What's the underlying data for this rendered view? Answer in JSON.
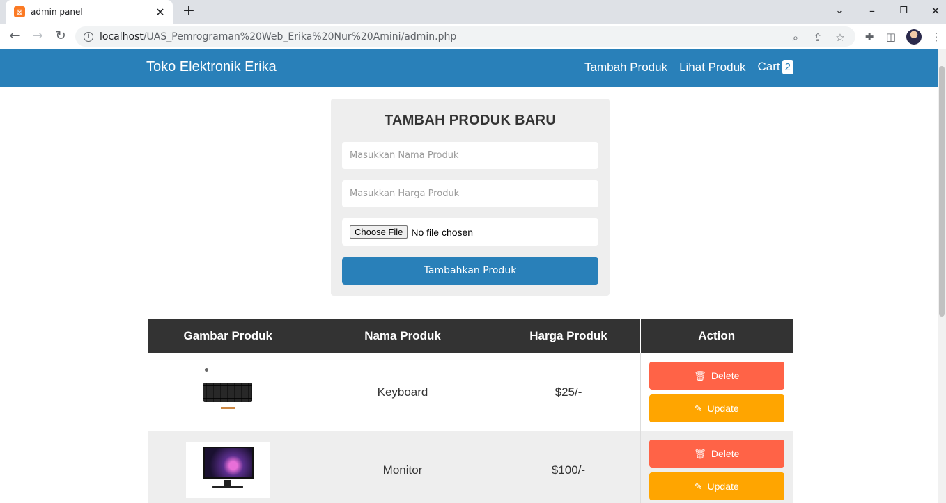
{
  "browser": {
    "tab_title": "admin panel",
    "url_host": "localhost",
    "url_path": "/UAS_Pemrograman%20Web_Erika%20Nur%20Amini/admin.php"
  },
  "header": {
    "logo": "Toko Elektronik Erika",
    "nav": {
      "add_product": "Tambah Produk",
      "view_products": "Lihat Produk",
      "cart": "Cart",
      "cart_count": "2"
    }
  },
  "form": {
    "title": "TAMBAH PRODUK BARU",
    "name_placeholder": "Masukkan Nama Produk",
    "price_placeholder": "Masukkan Harga Produk",
    "file_button": "Choose File",
    "file_status": "No file chosen",
    "submit_label": "Tambahkan Produk"
  },
  "table": {
    "headers": [
      "Gambar Produk",
      "Nama Produk",
      "Harga Produk",
      "Action"
    ],
    "rows": [
      {
        "name": "Keyboard",
        "price": "$25/-",
        "delete_label": "Delete",
        "update_label": "Update"
      },
      {
        "name": "Monitor",
        "price": "$100/-",
        "delete_label": "Delete",
        "update_label": "Update"
      }
    ]
  },
  "colors": {
    "primary": "#2980b9",
    "delete": "#ff6347",
    "update": "#ffa500",
    "table_header": "#333333"
  }
}
